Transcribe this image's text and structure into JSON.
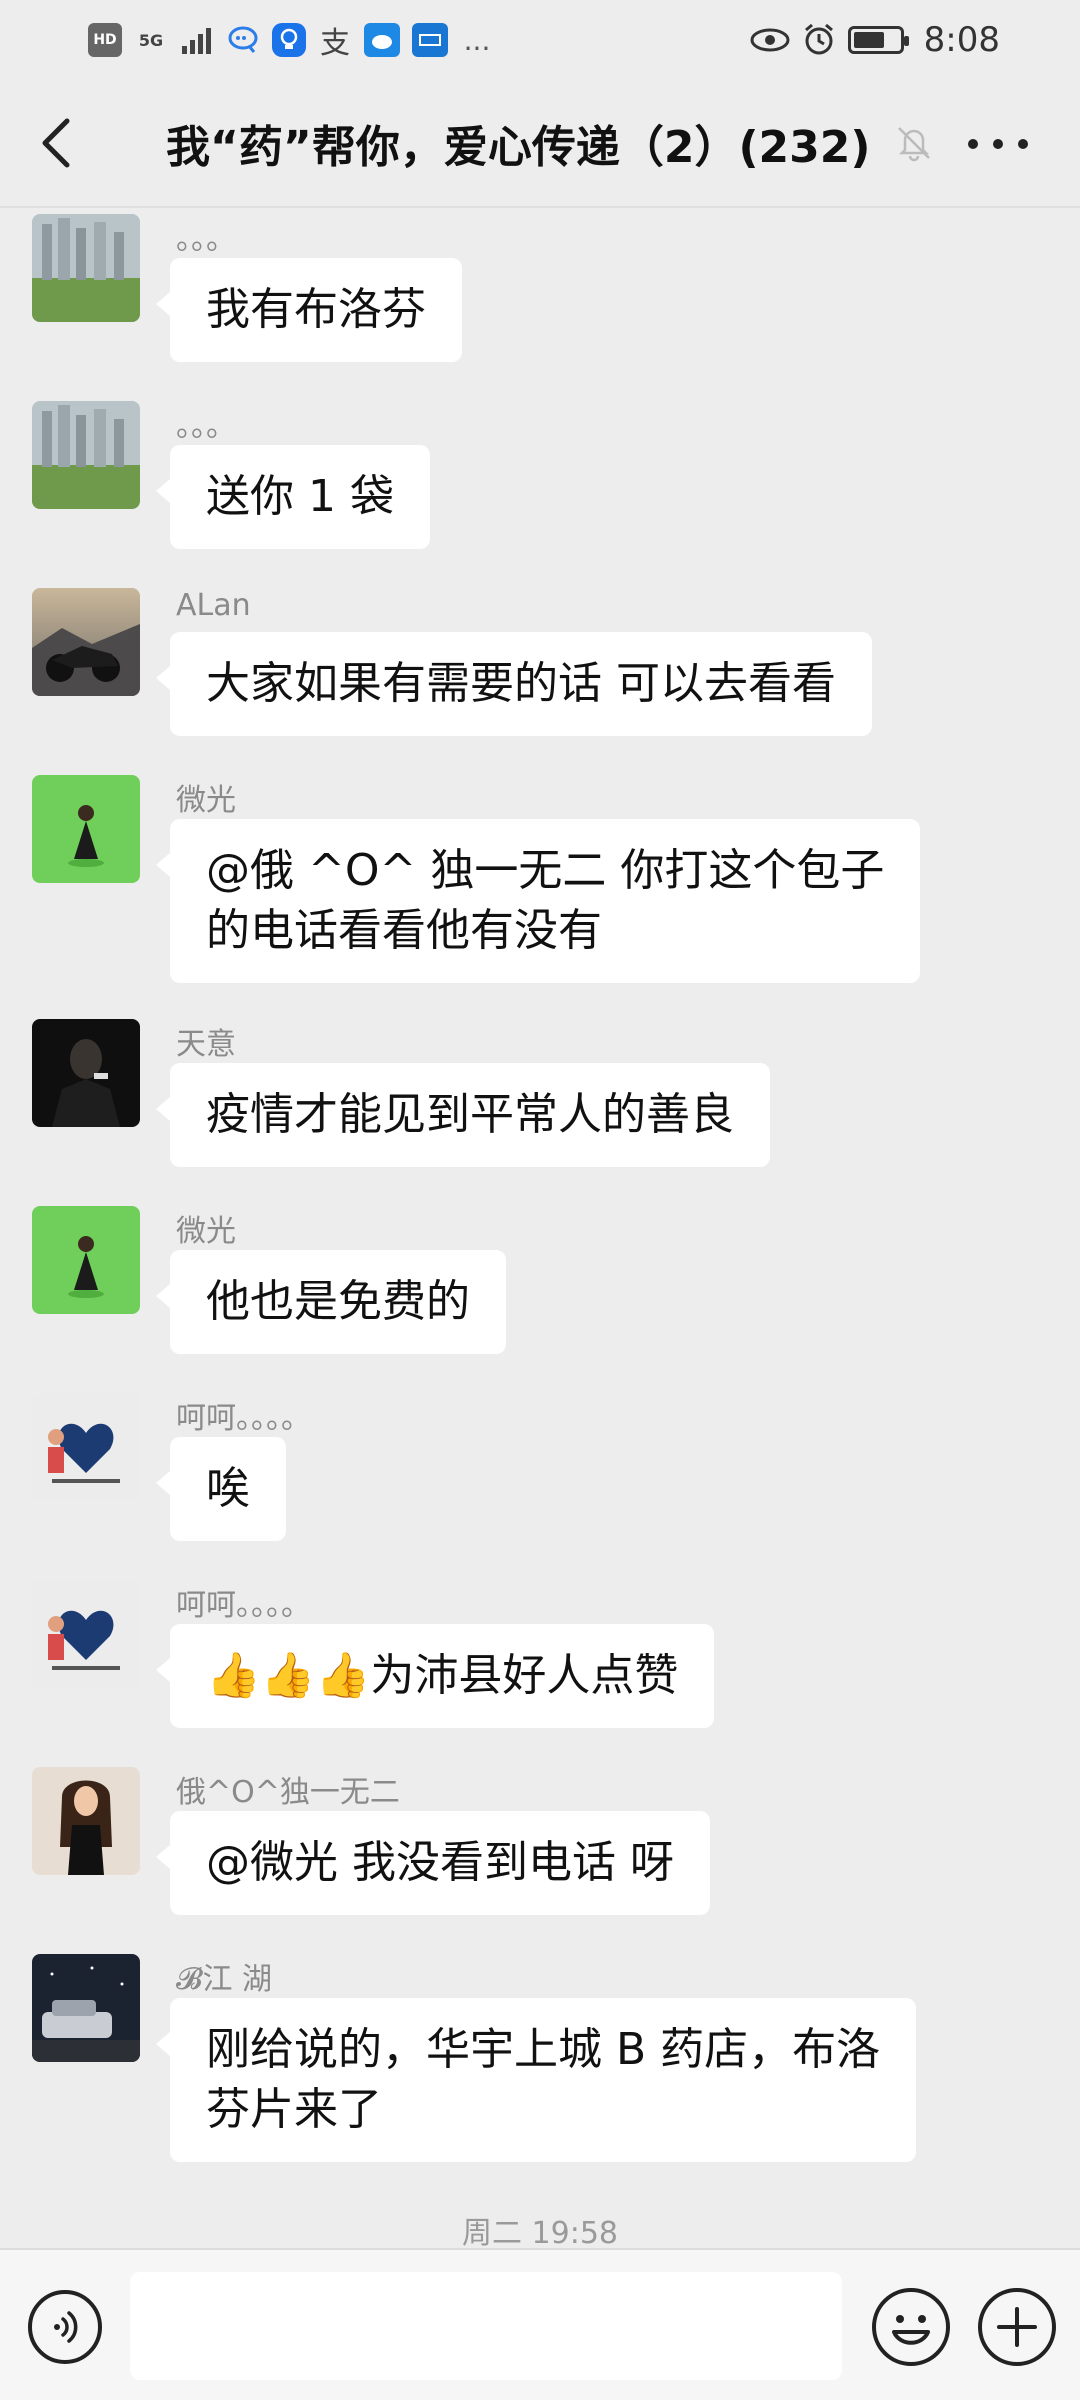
{
  "status_bar": {
    "left_icons": [
      "HD",
      "5G",
      "signal-icon",
      "chat-bubble-icon",
      "bulb-icon",
      "支",
      "weibo-icon",
      "news-icon",
      "..."
    ],
    "right_icons": [
      "eye-icon",
      "alarm-icon",
      "battery-icon"
    ],
    "time": "8:08"
  },
  "header": {
    "title": "我“药”帮你，爱心传递（2）(232)",
    "back_icon": "chevron-left-icon",
    "mute_icon": "bell-off-icon",
    "more_icon": "more-icon"
  },
  "messages": [
    {
      "sender": "。。。",
      "text": "我有布洛芬",
      "avatar": "city-park"
    },
    {
      "sender": "。。。",
      "text": "送你 1 袋",
      "avatar": "city-park"
    },
    {
      "sender": "ALan",
      "text": "大家如果有需要的话 可以去看看",
      "avatar": "motorcycle"
    },
    {
      "sender": "微光",
      "text_lines": [
        "@俄 ^O^ 独一无二  你打这个包子",
        "的电话看看他有没有"
      ],
      "avatar": "girl-grass"
    },
    {
      "sender": "天意",
      "text": "疫情才能见到平常人的善良",
      "avatar": "man-dark"
    },
    {
      "sender": "微光",
      "text": "他也是免费的",
      "avatar": "girl-grass"
    },
    {
      "sender": "呵呵。。。。",
      "text": "唉",
      "avatar": "couple-heart"
    },
    {
      "sender": "呵呵。。。。",
      "text": "👍👍👍为沛县好人点赞",
      "avatar": "couple-heart"
    },
    {
      "sender": "俄^O^独一无二",
      "text": "@微光   我没看到电话  呀",
      "avatar": "woman-black"
    },
    {
      "sender": "𝓑江   湖",
      "text_lines": [
        "刚给说的，华宇上城 B 药店，布洛",
        "芬片来了"
      ],
      "avatar": "car-night"
    }
  ],
  "timestamp": "周二 19:58",
  "input_bar": {
    "voice_icon": "voice-icon",
    "text_value": "",
    "emoji_icon": "emoji-icon",
    "plus_icon": "plus-icon"
  },
  "colors": {
    "background": "#ededed",
    "bubble": "#ffffff",
    "name_text": "#8a8a8a"
  }
}
